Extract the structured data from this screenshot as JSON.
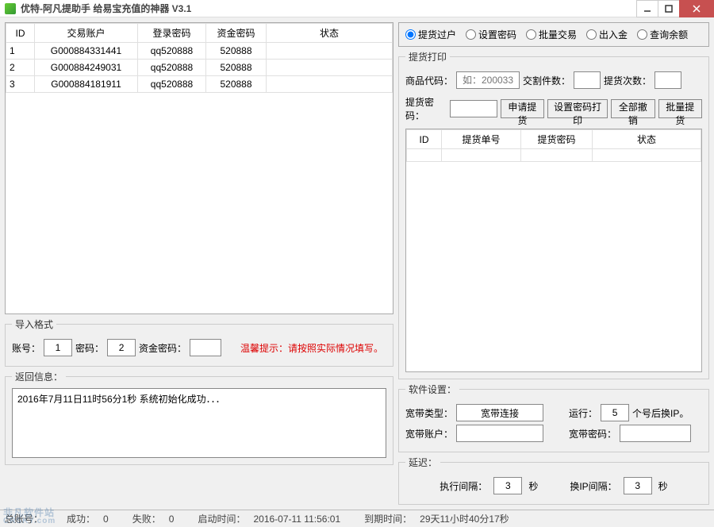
{
  "window": {
    "title": "优特-阿凡提助手 给易宝充值的神器  V3.1"
  },
  "left_table": {
    "headers": [
      "ID",
      "交易账户",
      "登录密码",
      "资金密码",
      "状态"
    ],
    "rows": [
      {
        "id": "1",
        "account": "G000884331441",
        "login_pw": "qq520888",
        "fund_pw": "520888",
        "status": ""
      },
      {
        "id": "2",
        "account": "G000884249031",
        "login_pw": "qq520888",
        "fund_pw": "520888",
        "status": ""
      },
      {
        "id": "3",
        "account": "G000884181911",
        "login_pw": "qq520888",
        "fund_pw": "520888",
        "status": ""
      }
    ]
  },
  "import_format": {
    "legend": "导入格式",
    "account_label": "账号：",
    "account_val": "1",
    "pw_label": "密码：",
    "pw_val": "2",
    "fund_label": "资金密码：",
    "fund_val": "",
    "tip": "温馨提示：请按照实际情况填写。"
  },
  "return_info": {
    "legend": "返回信息：",
    "log": "2016年7月11日11时56分1秒    系统初始化成功．．．"
  },
  "modes": {
    "opt1": "提货过户",
    "opt2": "设置密码",
    "opt3": "批量交易",
    "opt4": "出入金",
    "opt5": "查询余额"
  },
  "pickup": {
    "legend": "提货打印",
    "code_label": "商品代码：",
    "code_placeholder": "如：200033",
    "count_label": "交割件数：",
    "times_label": "提货次数：",
    "pw_label": "提货密码：",
    "btn_apply": "申请提货",
    "btn_print": "设置密码打印",
    "btn_cancel": "全部撤销",
    "btn_batch": "批量提货",
    "headers": [
      "ID",
      "提货单号",
      "提货密码",
      "状态"
    ]
  },
  "settings": {
    "legend": "软件设置：",
    "type_label": "宽带类型：",
    "type_val": "宽带连接",
    "run_label": "运行：",
    "run_val": "5",
    "run_suffix": "个号后换IP。",
    "acct_label": "宽带账户：",
    "pw_label": "宽带密码："
  },
  "delay": {
    "legend": "延迟：",
    "exec_label": "执行间隔：",
    "exec_val": "3",
    "sec": "秒",
    "ip_label": "换IP间隔：",
    "ip_val": "3"
  },
  "status": {
    "total_label": "总账号：",
    "success_label": "成功：",
    "success_val": "0",
    "fail_label": "失败：",
    "fail_val": "0",
    "start_label": "启动时间：",
    "start_val": "2016-07-11 11:56:01",
    "end_label": "到期时间：",
    "end_val": "29天11小时40分17秒"
  },
  "watermark": {
    "text": "非凡软件站",
    "sub": "CRSKY.com"
  }
}
